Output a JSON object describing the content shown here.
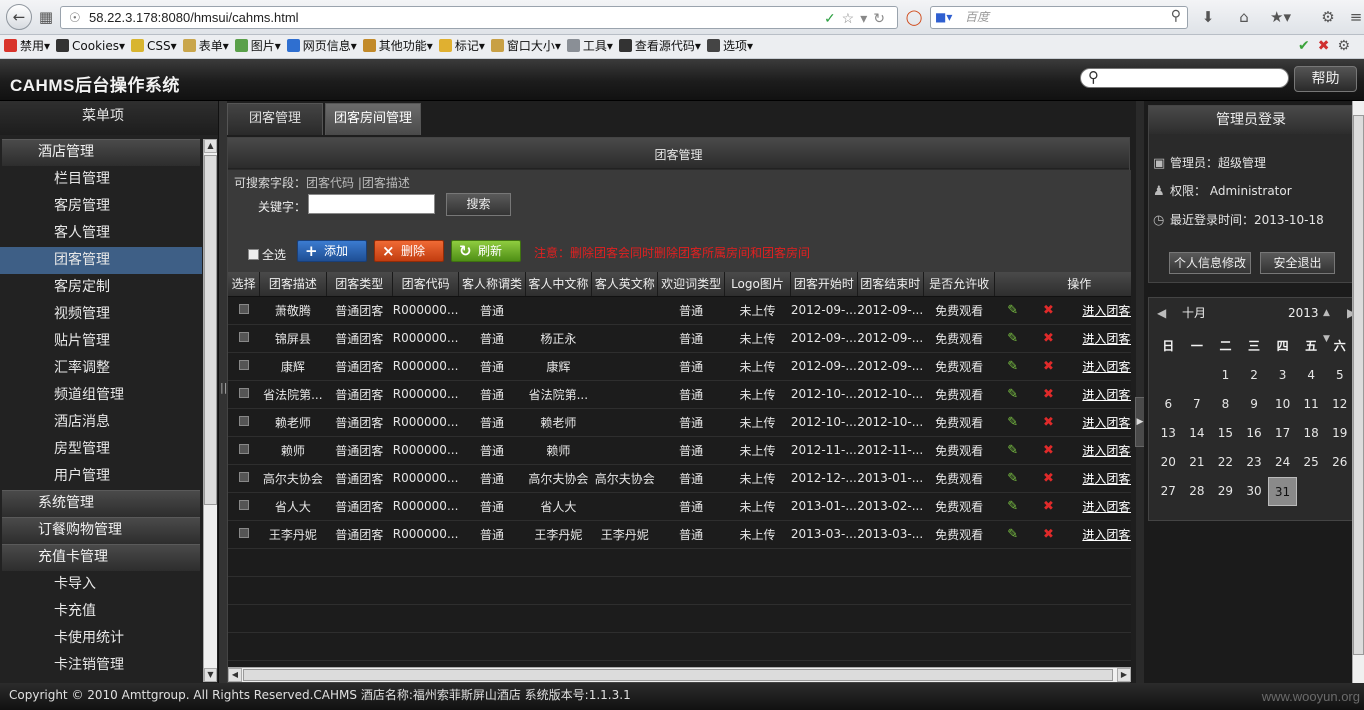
{
  "browser": {
    "url": "58.22.3.178:8080/hmsui/cahms.html",
    "search_placeholder": "百度",
    "bookmarks": [
      "禁用▾",
      "Cookies▾",
      "CSS▾",
      "表单▾",
      "图片▾",
      "网页信息▾",
      "其他功能▾",
      "标记▾",
      "窗口大小▾",
      "工具▾",
      "查看源代码▾",
      "选项▾"
    ],
    "bookmark_colors": [
      "#d9342b",
      "#333333",
      "#d8b530",
      "#c9a64c",
      "#5aa04a",
      "#2f6fd0",
      "#c28a2a",
      "#e0b030",
      "#c8a045",
      "#8a8f96",
      "#333333",
      "#444444"
    ]
  },
  "app": {
    "title": "CAHMS后台操作系统",
    "help_label": "帮助"
  },
  "sidebar": {
    "title": "菜单项",
    "entries": [
      {
        "type": "group",
        "label": "酒店管理"
      },
      {
        "type": "item",
        "label": "栏目管理"
      },
      {
        "type": "item",
        "label": "客房管理"
      },
      {
        "type": "item",
        "label": "客人管理"
      },
      {
        "type": "item",
        "label": "团客管理",
        "active": true
      },
      {
        "type": "item",
        "label": "客房定制"
      },
      {
        "type": "item",
        "label": "视频管理"
      },
      {
        "type": "item",
        "label": "贴片管理"
      },
      {
        "type": "item",
        "label": "汇率调整"
      },
      {
        "type": "item",
        "label": "频道组管理"
      },
      {
        "type": "item",
        "label": "酒店消息"
      },
      {
        "type": "item",
        "label": "房型管理"
      },
      {
        "type": "item",
        "label": "用户管理"
      },
      {
        "type": "group",
        "label": "系统管理"
      },
      {
        "type": "group",
        "label": "订餐购物管理"
      },
      {
        "type": "group",
        "label": "充值卡管理"
      },
      {
        "type": "item",
        "label": "卡导入"
      },
      {
        "type": "item",
        "label": "卡充值"
      },
      {
        "type": "item",
        "label": "卡使用统计"
      },
      {
        "type": "item",
        "label": "卡注销管理"
      }
    ]
  },
  "tabs": [
    {
      "label": "团客管理"
    },
    {
      "label": "团客房间管理",
      "active": true
    }
  ],
  "panel": {
    "title": "团客管理",
    "search_fields_label": "可搜索字段：",
    "search_fields": "团客代码 |团客描述",
    "keyword_label": "关键字：",
    "keyword_value": "",
    "search_button": "搜索",
    "select_all": "全选",
    "add_button": "添加",
    "delete_button": "删除",
    "refresh_button": "刷新",
    "warning": "注意：删除团客会同时删除团客所属房间和团客房间"
  },
  "table": {
    "columns": [
      "选择",
      "团客描述",
      "团客类型",
      "团客代码",
      "客人称谓类",
      "客人中文称",
      "客人英文称",
      "欢迎词类型",
      "Logo图片",
      "团客开始时",
      "团客结束时",
      "是否允许收",
      "操作"
    ],
    "enter_link": "进入团客行程",
    "rows": [
      {
        "desc": "萧敬腾",
        "type": "普通团客",
        "code": "R000000...",
        "title": "普通",
        "cn": "",
        "en": "",
        "welcome": "普通",
        "logo": "未上传",
        "start": "2012-09-...",
        "end": "2012-09-...",
        "charge": "免费观看"
      },
      {
        "desc": "锦屏县",
        "type": "普通团客",
        "code": "R000000...",
        "title": "普通",
        "cn": "杨正永",
        "en": "",
        "welcome": "普通",
        "logo": "未上传",
        "start": "2012-09-...",
        "end": "2012-09-...",
        "charge": "免费观看"
      },
      {
        "desc": "康辉",
        "type": "普通团客",
        "code": "R000000...",
        "title": "普通",
        "cn": "康辉",
        "en": "",
        "welcome": "普通",
        "logo": "未上传",
        "start": "2012-09-...",
        "end": "2012-09-...",
        "charge": "免费观看"
      },
      {
        "desc": "省法院第...",
        "type": "普通团客",
        "code": "R000000...",
        "title": "普通",
        "cn": "省法院第...",
        "en": "",
        "welcome": "普通",
        "logo": "未上传",
        "start": "2012-10-...",
        "end": "2012-10-...",
        "charge": "免费观看"
      },
      {
        "desc": "赖老师",
        "type": "普通团客",
        "code": "R000000...",
        "title": "普通",
        "cn": "赖老师",
        "en": "",
        "welcome": "普通",
        "logo": "未上传",
        "start": "2012-10-...",
        "end": "2012-10-...",
        "charge": "免费观看"
      },
      {
        "desc": "赖师",
        "type": "普通团客",
        "code": "R000000...",
        "title": "普通",
        "cn": "赖师",
        "en": "",
        "welcome": "普通",
        "logo": "未上传",
        "start": "2012-11-...",
        "end": "2012-11-...",
        "charge": "免费观看"
      },
      {
        "desc": "高尔夫协会",
        "type": "普通团客",
        "code": "R000000...",
        "title": "普通",
        "cn": "高尔夫协会",
        "en": "高尔夫协会",
        "welcome": "普通",
        "logo": "未上传",
        "start": "2012-12-...",
        "end": "2013-01-...",
        "charge": "免费观看"
      },
      {
        "desc": "省人大",
        "type": "普通团客",
        "code": "R000000...",
        "title": "普通",
        "cn": "省人大",
        "en": "",
        "welcome": "普通",
        "logo": "未上传",
        "start": "2013-01-...",
        "end": "2013-02-...",
        "charge": "免费观看"
      },
      {
        "desc": "王李丹妮",
        "type": "普通团客",
        "code": "R000000...",
        "title": "普通",
        "cn": "王李丹妮",
        "en": "王李丹妮",
        "welcome": "普通",
        "logo": "未上传",
        "start": "2013-03-...",
        "end": "2013-03-...",
        "charge": "免费观看"
      }
    ]
  },
  "login": {
    "title": "管理员登录",
    "admin_label": "管理员：",
    "admin_value": "超级管理",
    "perm_label": "权限：",
    "perm_value": "Administrator",
    "last_login_label": "最近登录时间：",
    "last_login_value": "2013-10-18",
    "edit_button": "个人信息修改",
    "logout_button": "安全退出"
  },
  "calendar": {
    "month": "十月",
    "year": "2013",
    "weekdays": [
      "日",
      "一",
      "二",
      "三",
      "四",
      "五",
      "六"
    ],
    "weeks": [
      [
        "",
        "",
        "1",
        "2",
        "3",
        "4",
        "5"
      ],
      [
        "6",
        "7",
        "8",
        "9",
        "10",
        "11",
        "12"
      ],
      [
        "13",
        "14",
        "15",
        "16",
        "17",
        "18",
        "19"
      ],
      [
        "20",
        "21",
        "22",
        "23",
        "24",
        "25",
        "26"
      ],
      [
        "27",
        "28",
        "29",
        "30",
        "31",
        "",
        ""
      ]
    ],
    "selected_day": "31"
  },
  "footer": {
    "text": "Copyright © 2010 Amttgroup. All Rights Reserved.CAHMS   酒店名称:福州索菲斯屏山酒店   系统版本号:1.1.3.1",
    "watermark": "www.wooyun.org"
  }
}
